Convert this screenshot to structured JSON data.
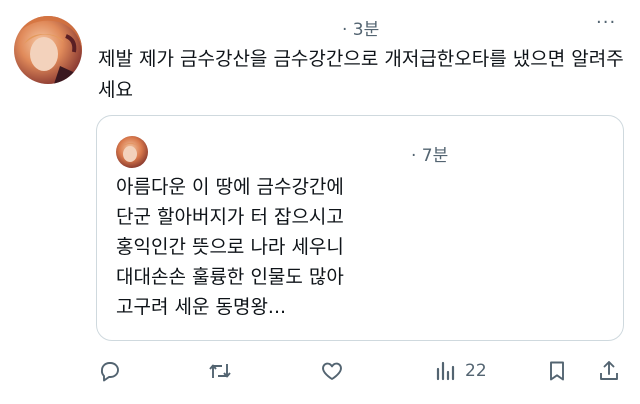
{
  "tweet": {
    "time": "· 3분",
    "more": "···",
    "text": "제발 제가 금수강산을 금수강간으로 개저급한오타를 냈으면 알려주세요"
  },
  "quote": {
    "time": "· 7분",
    "lines": [
      "아름다운 이 땅에 금수강간에",
      "단군 할아버지가 터 잡으시고",
      "홍익인간 뜻으로 나라 세우니",
      "대대손손 훌륭한 인물도 많아",
      "고구려 세운 동명왕..."
    ]
  },
  "actions": {
    "views_count": "22"
  },
  "icons": {
    "reply": "reply-icon",
    "retweet": "retweet-icon",
    "like": "heart-icon",
    "views": "views-icon",
    "bookmark": "bookmark-icon",
    "share": "share-icon"
  },
  "colors": {
    "text": "#0f1419",
    "secondary": "#536471",
    "border": "#cfd9de"
  }
}
